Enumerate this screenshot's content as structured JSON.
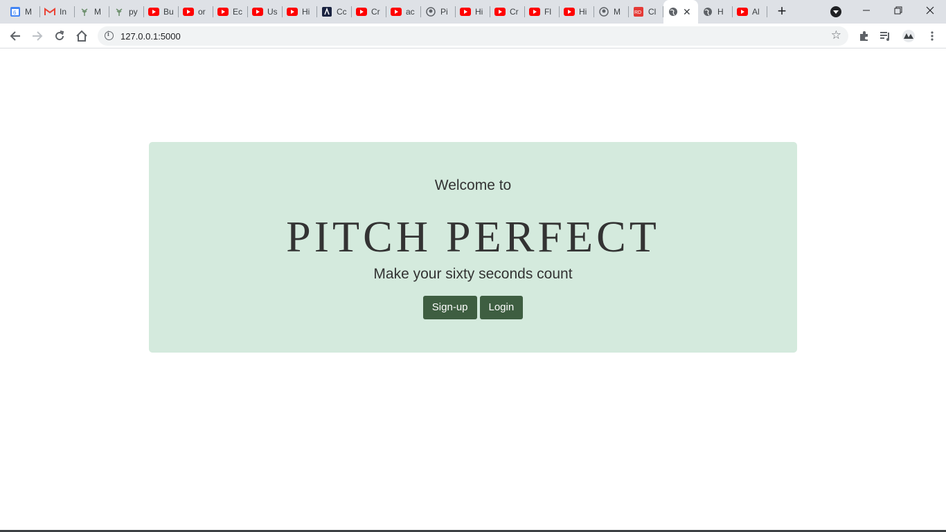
{
  "browser": {
    "tabs": [
      {
        "title": "M",
        "icon": "calendar-icon",
        "color": "#4285f4"
      },
      {
        "title": "In",
        "icon": "gmail-icon",
        "color": "#ea4335"
      },
      {
        "title": "M",
        "icon": "plant-icon",
        "color": "#6b8e6b"
      },
      {
        "title": "py",
        "icon": "plant-icon",
        "color": "#6b8e6b"
      },
      {
        "title": "Bu",
        "icon": "youtube-icon",
        "color": "#ff0000"
      },
      {
        "title": "or",
        "icon": "youtube-icon",
        "color": "#ff0000"
      },
      {
        "title": "Ec",
        "icon": "youtube-icon",
        "color": "#ff0000"
      },
      {
        "title": "Us",
        "icon": "youtube-icon",
        "color": "#ff0000"
      },
      {
        "title": "Hi",
        "icon": "youtube-icon",
        "color": "#ff0000"
      },
      {
        "title": "Cc",
        "icon": "app-icon",
        "color": "#1a2340"
      },
      {
        "title": "Cr",
        "icon": "youtube-icon",
        "color": "#ff0000"
      },
      {
        "title": "ac",
        "icon": "youtube-icon",
        "color": "#ff0000"
      },
      {
        "title": "Pi",
        "icon": "github-icon",
        "color": "#5f6368"
      },
      {
        "title": "Hi",
        "icon": "youtube-icon",
        "color": "#ff0000"
      },
      {
        "title": "Cr",
        "icon": "youtube-icon",
        "color": "#ff0000"
      },
      {
        "title": "Fl",
        "icon": "youtube-icon",
        "color": "#ff0000"
      },
      {
        "title": "Hi",
        "icon": "youtube-icon",
        "color": "#ff0000"
      },
      {
        "title": "M",
        "icon": "github-icon",
        "color": "#5f6368"
      },
      {
        "title": "Cl",
        "icon": "rd-icon",
        "color": "#e53935"
      },
      {
        "title": "",
        "icon": "globe-icon",
        "color": "#5f6368",
        "active": true
      },
      {
        "title": "H",
        "icon": "globe-icon",
        "color": "#5f6368"
      },
      {
        "title": "Al",
        "icon": "youtube-icon",
        "color": "#ff0000"
      }
    ],
    "new_tab": "+",
    "url": "127.0.0.1:5000"
  },
  "page": {
    "welcome": "Welcome to",
    "brand": "PITCH PERFECT",
    "tagline": "Make your sixty seconds count",
    "signup_label": "Sign-up",
    "login_label": "Login"
  }
}
